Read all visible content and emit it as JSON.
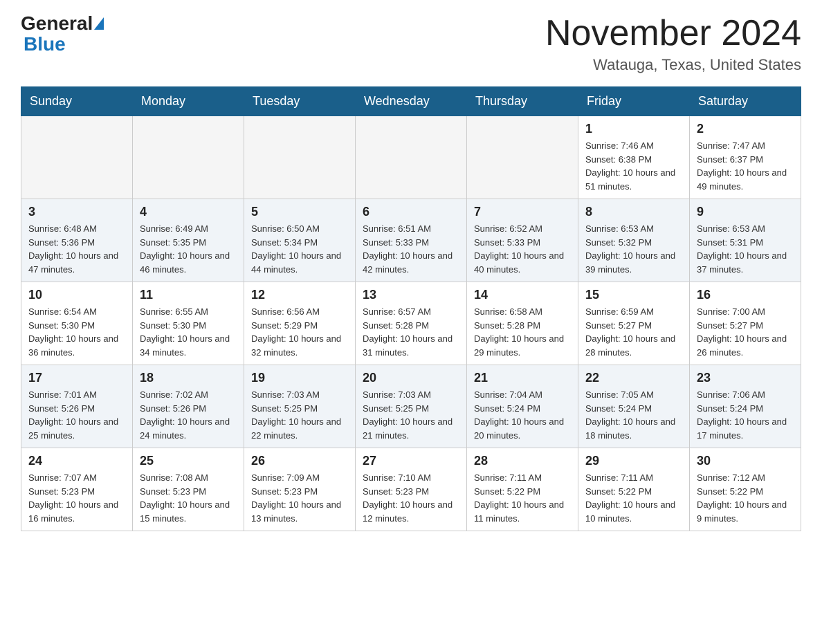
{
  "header": {
    "logo_general": "General",
    "logo_blue": "Blue",
    "month_title": "November 2024",
    "location": "Watauga, Texas, United States"
  },
  "days_of_week": [
    "Sunday",
    "Monday",
    "Tuesday",
    "Wednesday",
    "Thursday",
    "Friday",
    "Saturday"
  ],
  "weeks": [
    [
      {
        "day": "",
        "info": ""
      },
      {
        "day": "",
        "info": ""
      },
      {
        "day": "",
        "info": ""
      },
      {
        "day": "",
        "info": ""
      },
      {
        "day": "",
        "info": ""
      },
      {
        "day": "1",
        "info": "Sunrise: 7:46 AM\nSunset: 6:38 PM\nDaylight: 10 hours and 51 minutes."
      },
      {
        "day": "2",
        "info": "Sunrise: 7:47 AM\nSunset: 6:37 PM\nDaylight: 10 hours and 49 minutes."
      }
    ],
    [
      {
        "day": "3",
        "info": "Sunrise: 6:48 AM\nSunset: 5:36 PM\nDaylight: 10 hours and 47 minutes."
      },
      {
        "day": "4",
        "info": "Sunrise: 6:49 AM\nSunset: 5:35 PM\nDaylight: 10 hours and 46 minutes."
      },
      {
        "day": "5",
        "info": "Sunrise: 6:50 AM\nSunset: 5:34 PM\nDaylight: 10 hours and 44 minutes."
      },
      {
        "day": "6",
        "info": "Sunrise: 6:51 AM\nSunset: 5:33 PM\nDaylight: 10 hours and 42 minutes."
      },
      {
        "day": "7",
        "info": "Sunrise: 6:52 AM\nSunset: 5:33 PM\nDaylight: 10 hours and 40 minutes."
      },
      {
        "day": "8",
        "info": "Sunrise: 6:53 AM\nSunset: 5:32 PM\nDaylight: 10 hours and 39 minutes."
      },
      {
        "day": "9",
        "info": "Sunrise: 6:53 AM\nSunset: 5:31 PM\nDaylight: 10 hours and 37 minutes."
      }
    ],
    [
      {
        "day": "10",
        "info": "Sunrise: 6:54 AM\nSunset: 5:30 PM\nDaylight: 10 hours and 36 minutes."
      },
      {
        "day": "11",
        "info": "Sunrise: 6:55 AM\nSunset: 5:30 PM\nDaylight: 10 hours and 34 minutes."
      },
      {
        "day": "12",
        "info": "Sunrise: 6:56 AM\nSunset: 5:29 PM\nDaylight: 10 hours and 32 minutes."
      },
      {
        "day": "13",
        "info": "Sunrise: 6:57 AM\nSunset: 5:28 PM\nDaylight: 10 hours and 31 minutes."
      },
      {
        "day": "14",
        "info": "Sunrise: 6:58 AM\nSunset: 5:28 PM\nDaylight: 10 hours and 29 minutes."
      },
      {
        "day": "15",
        "info": "Sunrise: 6:59 AM\nSunset: 5:27 PM\nDaylight: 10 hours and 28 minutes."
      },
      {
        "day": "16",
        "info": "Sunrise: 7:00 AM\nSunset: 5:27 PM\nDaylight: 10 hours and 26 minutes."
      }
    ],
    [
      {
        "day": "17",
        "info": "Sunrise: 7:01 AM\nSunset: 5:26 PM\nDaylight: 10 hours and 25 minutes."
      },
      {
        "day": "18",
        "info": "Sunrise: 7:02 AM\nSunset: 5:26 PM\nDaylight: 10 hours and 24 minutes."
      },
      {
        "day": "19",
        "info": "Sunrise: 7:03 AM\nSunset: 5:25 PM\nDaylight: 10 hours and 22 minutes."
      },
      {
        "day": "20",
        "info": "Sunrise: 7:03 AM\nSunset: 5:25 PM\nDaylight: 10 hours and 21 minutes."
      },
      {
        "day": "21",
        "info": "Sunrise: 7:04 AM\nSunset: 5:24 PM\nDaylight: 10 hours and 20 minutes."
      },
      {
        "day": "22",
        "info": "Sunrise: 7:05 AM\nSunset: 5:24 PM\nDaylight: 10 hours and 18 minutes."
      },
      {
        "day": "23",
        "info": "Sunrise: 7:06 AM\nSunset: 5:24 PM\nDaylight: 10 hours and 17 minutes."
      }
    ],
    [
      {
        "day": "24",
        "info": "Sunrise: 7:07 AM\nSunset: 5:23 PM\nDaylight: 10 hours and 16 minutes."
      },
      {
        "day": "25",
        "info": "Sunrise: 7:08 AM\nSunset: 5:23 PM\nDaylight: 10 hours and 15 minutes."
      },
      {
        "day": "26",
        "info": "Sunrise: 7:09 AM\nSunset: 5:23 PM\nDaylight: 10 hours and 13 minutes."
      },
      {
        "day": "27",
        "info": "Sunrise: 7:10 AM\nSunset: 5:23 PM\nDaylight: 10 hours and 12 minutes."
      },
      {
        "day": "28",
        "info": "Sunrise: 7:11 AM\nSunset: 5:22 PM\nDaylight: 10 hours and 11 minutes."
      },
      {
        "day": "29",
        "info": "Sunrise: 7:11 AM\nSunset: 5:22 PM\nDaylight: 10 hours and 10 minutes."
      },
      {
        "day": "30",
        "info": "Sunrise: 7:12 AM\nSunset: 5:22 PM\nDaylight: 10 hours and 9 minutes."
      }
    ]
  ]
}
